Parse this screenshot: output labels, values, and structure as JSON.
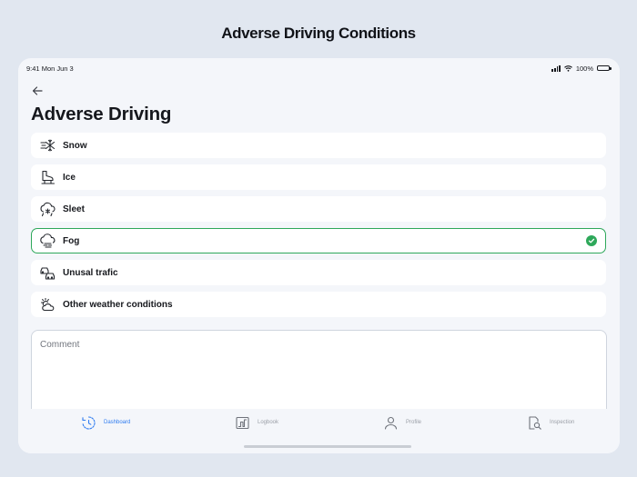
{
  "outer_title": "Adverse Driving Conditions",
  "status_bar": {
    "time": "9:41",
    "date": "Mon Jun 3",
    "battery": "100%"
  },
  "page": {
    "title": "Adverse Driving"
  },
  "options": [
    {
      "label": "Snow",
      "icon": "snow-wind-icon",
      "selected": false
    },
    {
      "label": "Ice",
      "icon": "ice-skate-icon",
      "selected": false
    },
    {
      "label": "Sleet",
      "icon": "sleet-cloud-icon",
      "selected": false
    },
    {
      "label": "Fog",
      "icon": "fog-cloud-icon",
      "selected": true
    },
    {
      "label": "Unusal trafic",
      "icon": "traffic-cars-icon",
      "selected": false
    },
    {
      "label": "Other weather conditions",
      "icon": "partly-cloudy-icon",
      "selected": false
    }
  ],
  "comment": {
    "placeholder": "Comment",
    "value": ""
  },
  "tabs": [
    {
      "label": "Dashboard",
      "icon": "dashboard-clock-icon",
      "active": true
    },
    {
      "label": "Logbook",
      "icon": "logbook-chart-icon",
      "active": false
    },
    {
      "label": "Profile",
      "icon": "profile-person-icon",
      "active": false
    },
    {
      "label": "Inspection",
      "icon": "inspection-doc-icon",
      "active": false
    }
  ],
  "colors": {
    "background": "#e1e7f0",
    "device": "#f4f6fa",
    "selected_border": "#2ea85a",
    "active_tab": "#2f7cf0",
    "inactive_tab": "#9a9ea6"
  }
}
